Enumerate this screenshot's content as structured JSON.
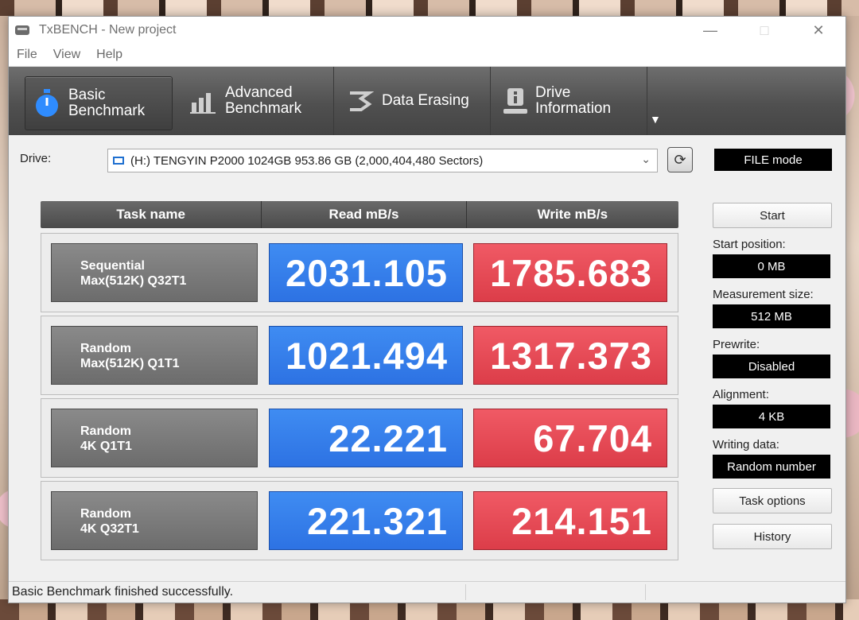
{
  "window": {
    "title": "TxBENCH - New project"
  },
  "menu": [
    "File",
    "View",
    "Help"
  ],
  "toolbar": {
    "tabs": [
      {
        "label": "Basic\nBenchmark",
        "icon": "stopwatch-icon"
      },
      {
        "label": "Advanced\nBenchmark",
        "icon": "bar-chart-icon"
      },
      {
        "label": "Data Erasing",
        "icon": "eraser-icon"
      },
      {
        "label": "Drive\nInformation",
        "icon": "drive-info-icon"
      }
    ]
  },
  "drive": {
    "label": "Drive:",
    "selected": "(H:) TENGYIN P2000 1024GB  953.86 GB (2,000,404,480 Sectors)",
    "mode": "FILE mode"
  },
  "table": {
    "headers": [
      "Task name",
      "Read mB/s",
      "Write mB/s"
    ],
    "rows": [
      {
        "task": "Sequential\nMax(512K) Q32T1",
        "read": "2031.105",
        "write": "1785.683"
      },
      {
        "task": "Random\nMax(512K) Q1T1",
        "read": "1021.494",
        "write": "1317.373"
      },
      {
        "task": "Random\n4K Q1T1",
        "read": "22.221",
        "write": "67.704"
      },
      {
        "task": "Random\n4K Q32T1",
        "read": "221.321",
        "write": "214.151"
      }
    ]
  },
  "side": {
    "start_label": "Start",
    "start_position_label": "Start position:",
    "start_position": "0 MB",
    "measurement_size_label": "Measurement size:",
    "measurement_size": "512 MB",
    "prewrite_label": "Prewrite:",
    "prewrite": "Disabled",
    "alignment_label": "Alignment:",
    "alignment": "4 KB",
    "writing_data_label": "Writing data:",
    "writing_data": "Random number",
    "task_options_label": "Task options",
    "history_label": "History"
  },
  "status": {
    "text": "Basic Benchmark finished successfully."
  },
  "colors": {
    "read": "#2f76e6",
    "write": "#e2434f",
    "toolbar": "#4f4f4f"
  }
}
